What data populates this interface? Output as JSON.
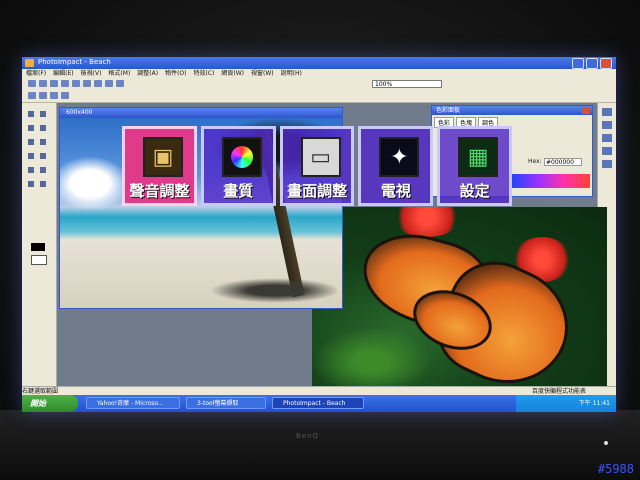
{
  "app": {
    "title": "PhotoImpact - Beach",
    "document_title": "600x400"
  },
  "menu": [
    "檔案(F)",
    "編輯(E)",
    "檢視(V)",
    "格式(M)",
    "調整(A)",
    "物件(O)",
    "特效(C)",
    "網頁(W)",
    "視窗(W)",
    "說明(H)"
  ],
  "toolbar": {
    "zoom_value": "100%"
  },
  "palette": {
    "title": "色彩面板",
    "tabs": [
      "色彩",
      "色塊",
      "調色"
    ],
    "hex_label": "Hex:",
    "hex_value": "#000000"
  },
  "osd_menu": {
    "items": [
      {
        "label": "聲音調整",
        "icon": "speaker-icon",
        "selected": true
      },
      {
        "label": "畫質",
        "icon": "color-wheel-icon",
        "selected": false
      },
      {
        "label": "畫面調整",
        "icon": "screen-adjust-icon",
        "selected": false
      },
      {
        "label": "電視",
        "icon": "satellite-icon",
        "selected": false
      },
      {
        "label": "設定",
        "icon": "settings-board-icon",
        "selected": false
      }
    ]
  },
  "statusbar": {
    "left": "右鍵選取範圍",
    "right": "百度快顯程式功能表"
  },
  "taskbar": {
    "start": "開始",
    "items": [
      {
        "label": "Yahoo!奇摩 - Microso...",
        "active": false
      },
      {
        "label": "3-tool螢幕擷取",
        "active": false
      },
      {
        "label": "PhotoImpact - Beach",
        "active": true
      }
    ],
    "clock": "下午 11:41"
  },
  "monitor": {
    "brand": "BenQ",
    "photo_id": "#5988"
  }
}
